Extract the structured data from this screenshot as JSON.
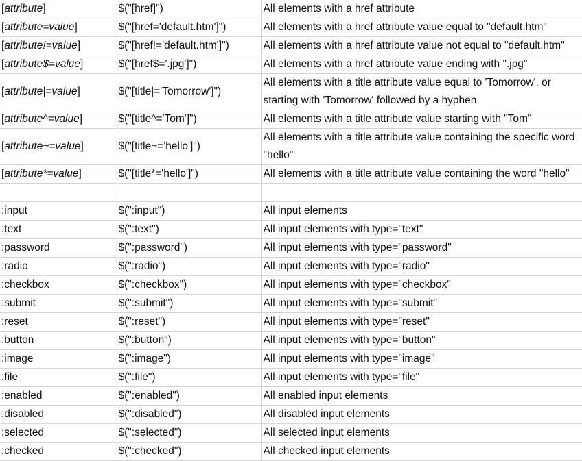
{
  "attribute_rows": [
    {
      "selector_pre": "[",
      "selector_em": "attribute",
      "selector_post": "]",
      "example": "$(\"[href]\")",
      "description": "All elements with a href attribute"
    },
    {
      "selector_pre": "[",
      "selector_em": "attribute=value",
      "selector_post": "]",
      "example": "$(\"[href='default.htm']\")",
      "description": "All elements with a href attribute value equal to \"default.htm\""
    },
    {
      "selector_pre": "[",
      "selector_em": "attribute!=value",
      "selector_post": "]",
      "example": "$(\"[href!='default.htm']\")",
      "description": "All elements with a href attribute value not equal to \"default.htm\""
    },
    {
      "selector_pre": "[",
      "selector_em": "attribute$=value",
      "selector_post": "]",
      "example": "$(\"[href$='.jpg']\")",
      "description": "All elements with a href attribute value ending with \".jpg\""
    },
    {
      "selector_pre": "[",
      "selector_em": "attribute|=value",
      "selector_post": "]",
      "example": "$(\"[title|='Tomorrow']\")",
      "description": "All elements with a title attribute value equal to 'Tomorrow', or starting with 'Tomorrow' followed by a hyphen"
    },
    {
      "selector_pre": "[",
      "selector_em": "attribute^=value",
      "selector_post": "]",
      "example": "$(\"[title^='Tom']\")",
      "description": "All elements with a title attribute value starting with \"Tom\""
    },
    {
      "selector_pre": "[",
      "selector_em": "attribute~=value",
      "selector_post": "]",
      "example": "$(\"[title~='hello']\")",
      "description": "All elements with a title attribute value containing the specific word \"hello\""
    },
    {
      "selector_pre": "[",
      "selector_em": "attribute*=value",
      "selector_post": "]",
      "example": "$(\"[title*='hello']\")",
      "description": "All elements with a title attribute value containing the word \"hello\""
    }
  ],
  "input_rows": [
    {
      "selector": ":input",
      "example": "$(\":input\")",
      "description": "All input elements"
    },
    {
      "selector": ":text",
      "example": "$(\":text\")",
      "description": "All input elements with type=\"text\""
    },
    {
      "selector": ":password",
      "example": "$(\":password\")",
      "description": "All input elements with type=\"password\""
    },
    {
      "selector": ":radio",
      "example": "$(\":radio\")",
      "description": "All input elements with type=\"radio\""
    },
    {
      "selector": ":checkbox",
      "example": "$(\":checkbox\")",
      "description": "All input elements with type=\"checkbox\""
    },
    {
      "selector": ":submit",
      "example": "$(\":submit\")",
      "description": "All input elements with type=\"submit\""
    },
    {
      "selector": ":reset",
      "example": "$(\":reset\")",
      "description": "All input elements with type=\"reset\""
    },
    {
      "selector": ":button",
      "example": "$(\":button\")",
      "description": "All input elements with type=\"button\""
    },
    {
      "selector": ":image",
      "example": "$(\":image\")",
      "description": "All input elements with type=\"image\""
    },
    {
      "selector": ":file",
      "example": "$(\":file\")",
      "description": "All input elements with type=\"file\""
    },
    {
      "selector": ":enabled",
      "example": "$(\":enabled\")",
      "description": "All enabled input elements"
    },
    {
      "selector": ":disabled",
      "example": "$(\":disabled\")",
      "description": "All disabled input elements"
    },
    {
      "selector": ":selected",
      "example": "$(\":selected\")",
      "description": "All selected input elements"
    },
    {
      "selector": ":checked",
      "example": "$(\":checked\")",
      "description": "All checked input elements"
    }
  ]
}
